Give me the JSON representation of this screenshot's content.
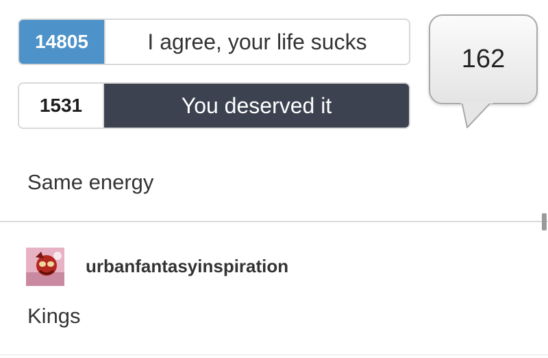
{
  "poll": {
    "options": [
      {
        "count": "14805",
        "label": "I agree, your life sucks"
      },
      {
        "count": "1531",
        "label": "You deserved it"
      }
    ],
    "comment_count": "162"
  },
  "post": {
    "caption": "Same energy"
  },
  "reblog": {
    "username": "urbanfantasyinspiration",
    "text": "Kings"
  },
  "colors": {
    "accent_blue": "#4d92c8",
    "dark_selected": "#3c4250"
  },
  "icons": {
    "comment_bubble": "speech-bubble-icon",
    "avatar": "user-avatar"
  }
}
